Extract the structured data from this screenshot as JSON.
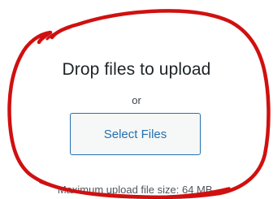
{
  "upload": {
    "title": "Drop files to upload",
    "or_text": "or",
    "select_label": "Select Files",
    "max_size_text": "Maximum upload file size: 64 MB."
  },
  "annotation": {
    "color": "#d01010"
  }
}
